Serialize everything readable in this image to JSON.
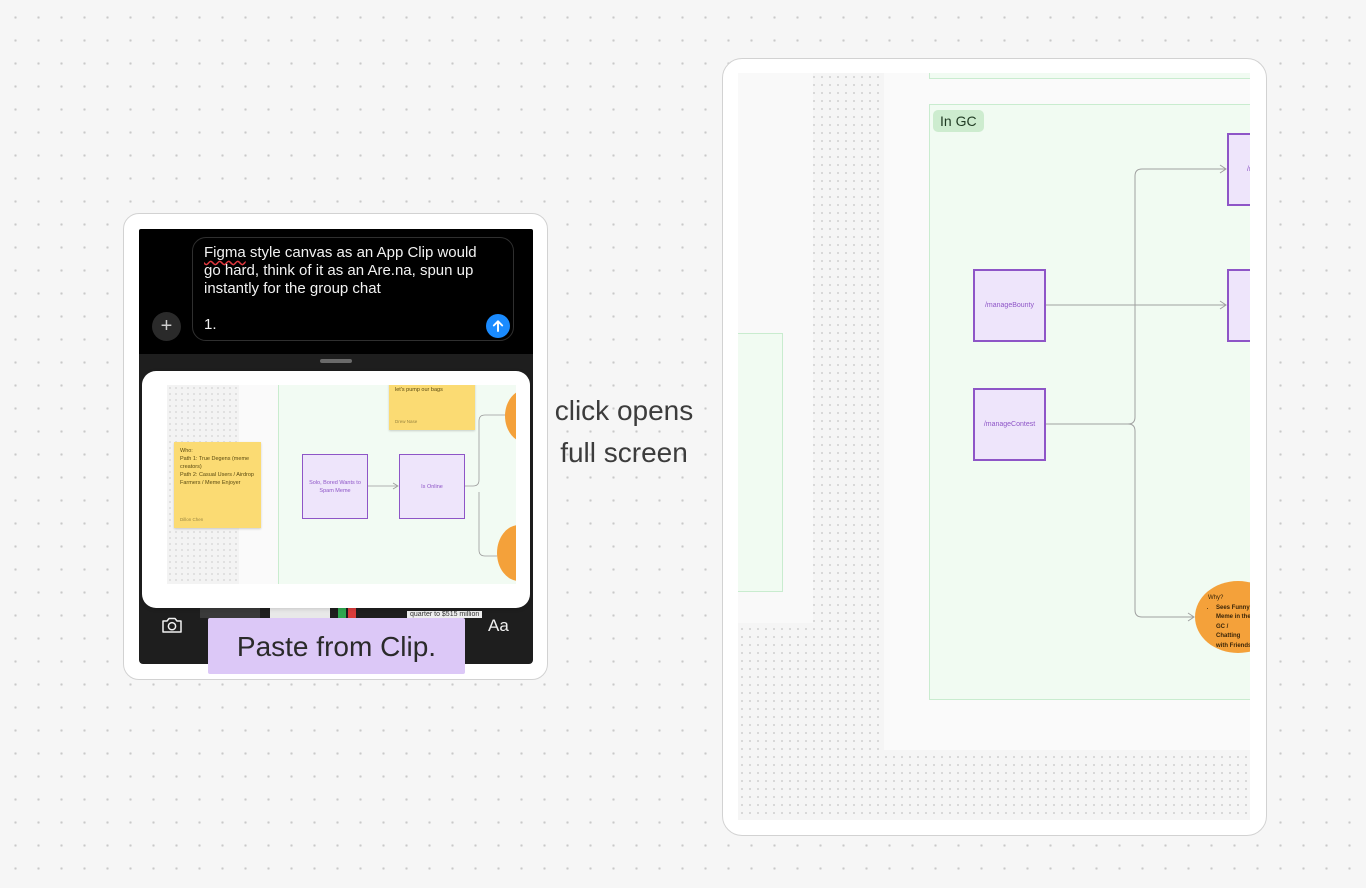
{
  "left_panel": {
    "message": {
      "text_misspelled_word": "Figma",
      "text_rest": " style canvas as an App Clip would go hard, think of it as an Are.na, spun up instantly for the group chat",
      "list_number": "1."
    },
    "plus_label": "+",
    "aa_label": "Aa",
    "tray_peek_text": "quarter to $515 million",
    "preview": {
      "sticky_top": {
        "text": "let's pump our bags",
        "author": "Drew Nase"
      },
      "sticky_who": {
        "lines": [
          "Who:",
          "Path 1: True Degens (meme creators)",
          "Path 2: Casual Users / Airdrop Farmers / Meme Enjoyer"
        ],
        "author": "Dillon Chen"
      },
      "node_1": "Solo, Bored Wants to Spam Meme",
      "node_2": "Is Online"
    },
    "caption": "Paste from Clip."
  },
  "annotation": {
    "line1": "click opens",
    "line2": "full screen"
  },
  "right_panel": {
    "section_label": "In GC",
    "nodes": {
      "bounty": "/manageBounty",
      "contest": "/manageContest",
      "top_right": "/n"
    },
    "why": {
      "title": "Why?",
      "bullet": "Sees Funny Meme in the GC / Chatting with Friends"
    }
  },
  "colors": {
    "canvas_bg": "#f6f6f6",
    "dark_bg": "#000000",
    "send_blue": "#1a8bff",
    "sticky_yellow": "#fbdb73",
    "node_purple": "#8e55c7",
    "node_fill": "#eee5fb",
    "bubble_orange": "#f4a13a",
    "section_green": "#f1fbf2",
    "caption_purple": "#dcc8f7"
  }
}
